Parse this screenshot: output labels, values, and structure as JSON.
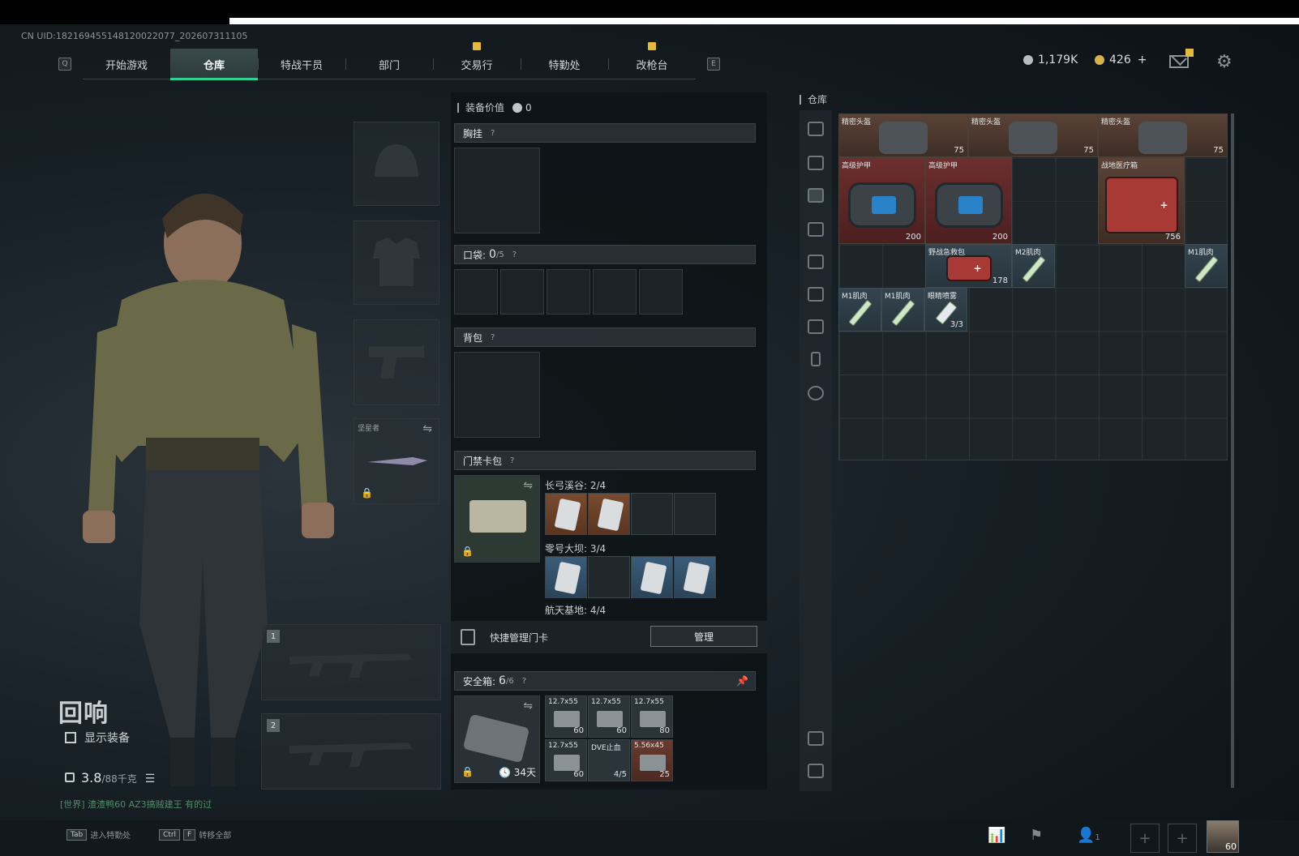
{
  "uid": "CN UID:182169455148120022077_202607311105",
  "nav": {
    "left_key": "Q",
    "right_key": "E",
    "tabs": [
      "开始游戏",
      "仓库",
      "特战干员",
      "部门",
      "交易行",
      "特勤处",
      "改枪台"
    ]
  },
  "currency": {
    "silver": "1,179K",
    "gold": "426",
    "gold_add": "+"
  },
  "character": {
    "name": "回响",
    "show_gear_label": "显示装备",
    "weight_current": "3.8",
    "weight_max": "/88千克",
    "chat": "[世界] 渣渣鸭60  AZ3搞贼建王 有的过"
  },
  "equipment": {
    "knife_label": "坚星者",
    "weapon_slot_1": "1",
    "weapon_slot_2": "2"
  },
  "gear": {
    "title": "装备价值",
    "value": "0",
    "chest_rig": "胸挂",
    "pocket_label": "口袋:",
    "pocket_count": "0",
    "pocket_max": "/5",
    "backpack": "背包",
    "keycard_section": "门禁卡包",
    "map1": "长弓溪谷: 2/4",
    "map2": "零号大坝: 3/4",
    "map3": "航天基地: 4/4",
    "quick_manage": "快捷管理门卡",
    "manage_btn": "管理",
    "safe_label": "安全箱:",
    "safe_count": "6",
    "safe_max": "/6",
    "safe_days": "34天",
    "safe_items": [
      {
        "t": "12.7x55",
        "n": "60"
      },
      {
        "t": "12.7x55",
        "n": "60"
      },
      {
        "t": "12.7x55",
        "n": "80"
      },
      {
        "t": "12.7x55",
        "n": "60"
      },
      {
        "t": "DVE止血",
        "n": "4/5"
      },
      {
        "t": "5.56x45",
        "n": "25"
      }
    ]
  },
  "warehouse": {
    "title": "仓库",
    "items": [
      {
        "name": "精密头盔",
        "val": "75"
      },
      {
        "name": "精密头盔",
        "val": "75"
      },
      {
        "name": "精密头盔",
        "val": "75"
      },
      {
        "name": "高级护甲",
        "val": "200"
      },
      {
        "name": "高级护甲",
        "val": "200"
      },
      {
        "name": "战地医疗箱",
        "val": "756"
      },
      {
        "name": "野战急救包",
        "val": "178"
      },
      {
        "name": "M2肌肉",
        "val": ""
      },
      {
        "name": "M1肌肉",
        "val": ""
      },
      {
        "name": "M1肌肉",
        "val": ""
      },
      {
        "name": "M1肌肉",
        "val": ""
      },
      {
        "name": "眼睛喷雾",
        "val": "3/3"
      }
    ]
  },
  "bottom": {
    "hint1_key": "Tab",
    "hint1": "进入特勤处",
    "hint2_key": "Ctrl",
    "hint2_key2": "F",
    "hint2": "转移全部",
    "friends_count": "1",
    "avatar_level": "60"
  },
  "colors": {
    "accent": "#2fd18e",
    "alert": "#e6b83a"
  }
}
